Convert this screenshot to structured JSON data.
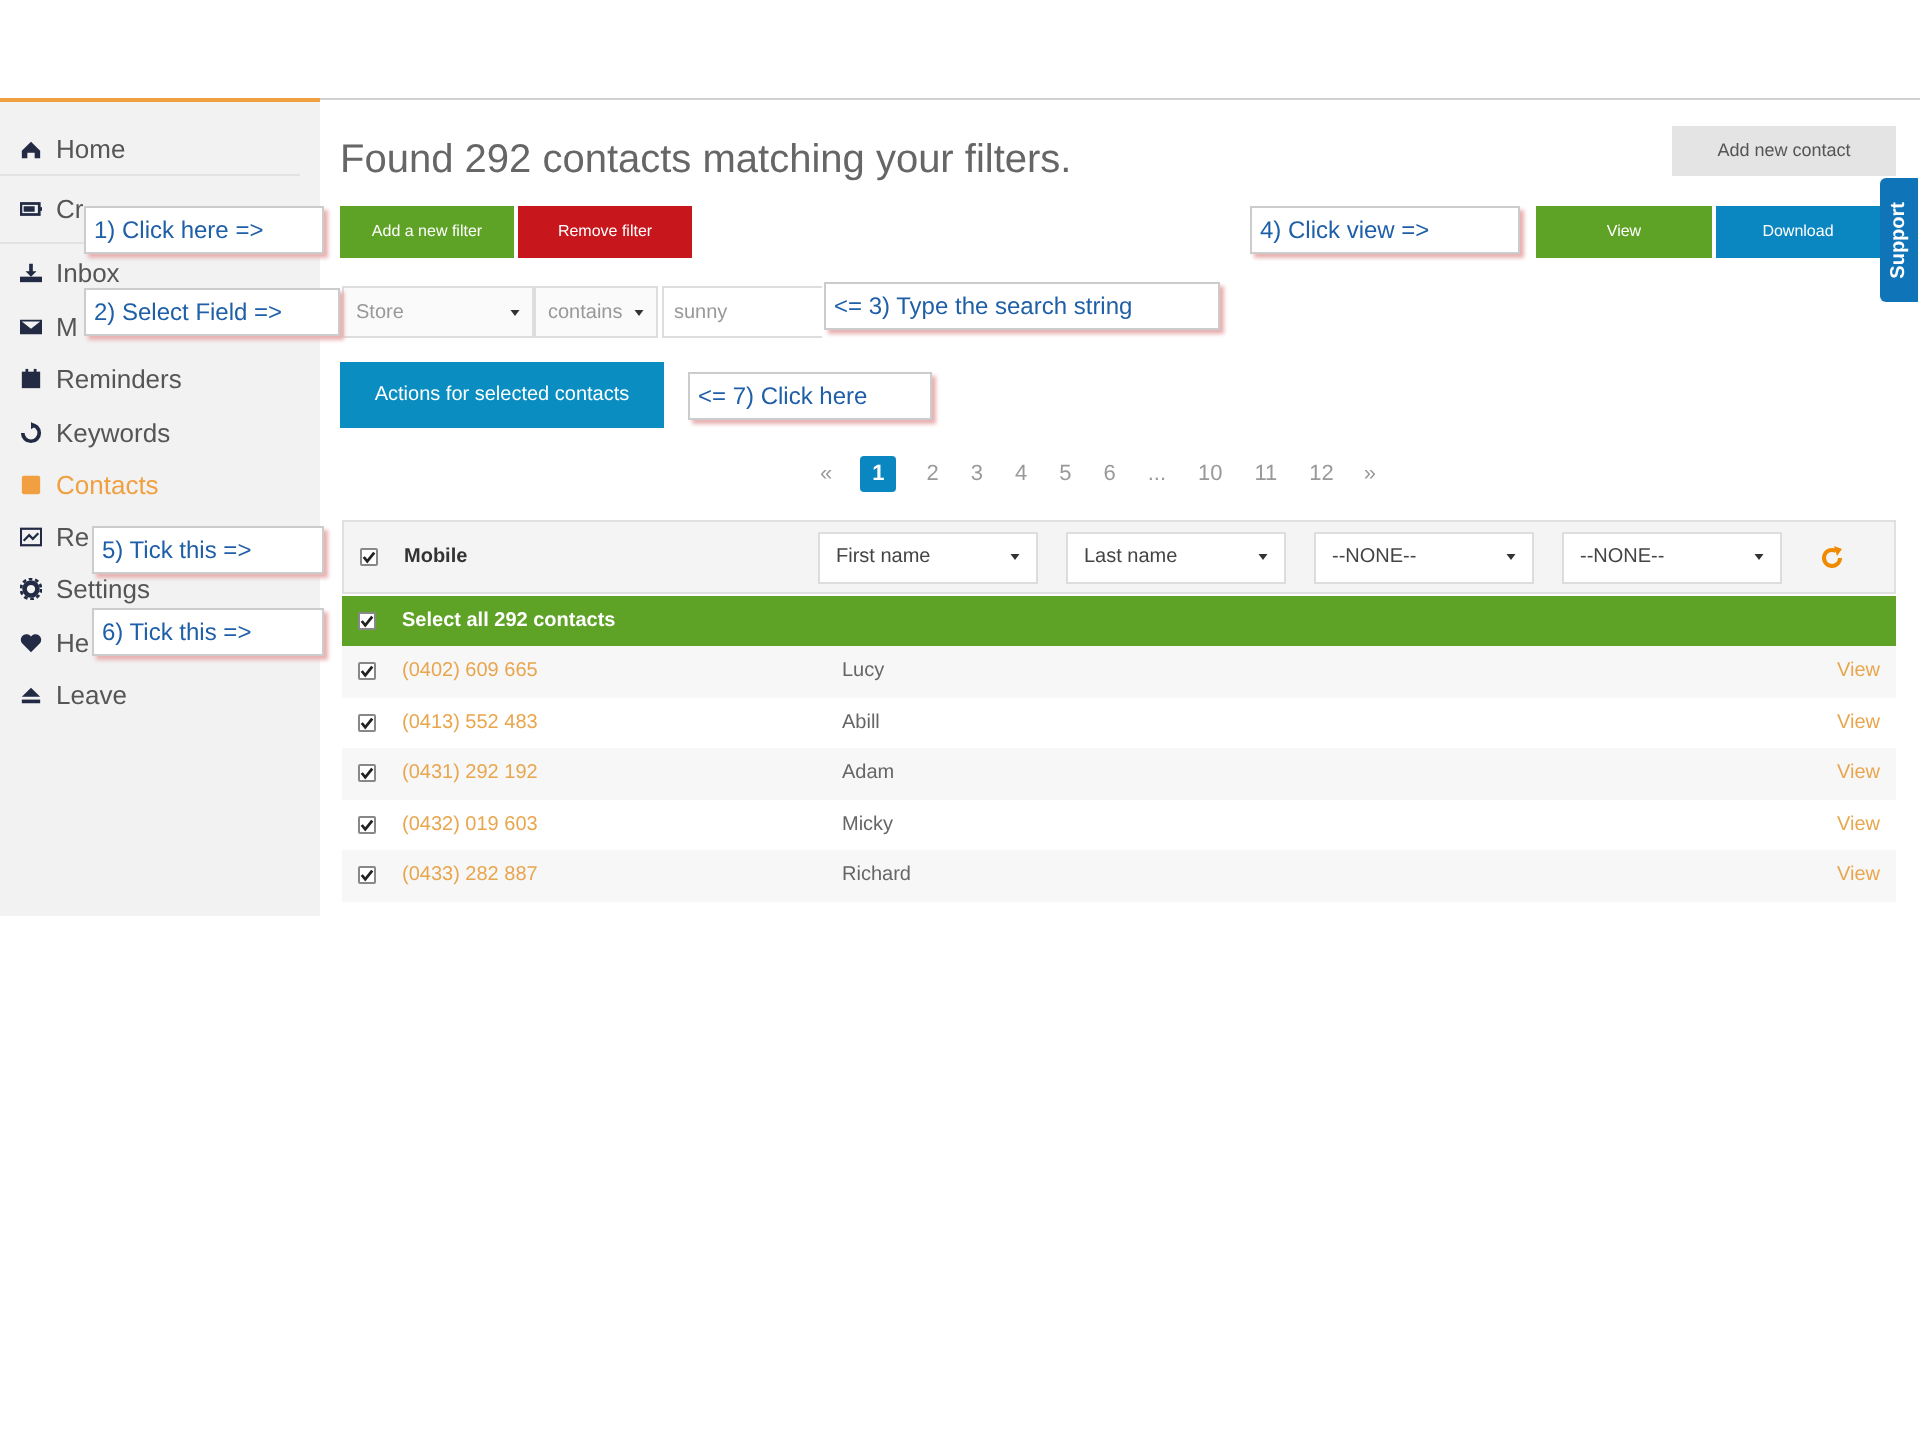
{
  "sidebar": {
    "items": [
      {
        "label": "Home",
        "selected": false
      },
      {
        "label": "Cr",
        "selected": false
      },
      {
        "label": "Inbox",
        "selected": false
      },
      {
        "label": "M",
        "selected": false
      },
      {
        "label": "Reminders",
        "selected": false
      },
      {
        "label": "Keywords",
        "selected": false
      },
      {
        "label": "Contacts",
        "selected": true
      },
      {
        "label": "Re",
        "selected": false
      },
      {
        "label": "Settings",
        "selected": false
      },
      {
        "label": "He",
        "selected": false
      },
      {
        "label": "Leave",
        "selected": false
      }
    ]
  },
  "heading": "Found 292 contacts matching your filters.",
  "add_contact_button": "Add new contact",
  "filter_buttons": [
    "Add a new filter",
    "Remove filter"
  ],
  "result_buttons": [
    "View",
    "Download"
  ],
  "support_tab": "Support",
  "filter": {
    "field": "Store",
    "operator": "contains",
    "value": "sunny"
  },
  "actions_button": "Actions for selected contacts",
  "pagination": {
    "prev": "«",
    "next": "»",
    "pages": [
      {
        "label": "1",
        "selected": true
      },
      {
        "label": "2",
        "selected": false
      },
      {
        "label": "3",
        "selected": false
      },
      {
        "label": "4",
        "selected": false
      },
      {
        "label": "5",
        "selected": false
      },
      {
        "label": "6",
        "selected": false
      },
      {
        "label": "...",
        "selected": false
      },
      {
        "label": "10",
        "selected": false
      },
      {
        "label": "11",
        "selected": false
      },
      {
        "label": "12",
        "selected": false
      }
    ]
  },
  "table": {
    "header": {
      "checked": true,
      "label": "Mobile",
      "column_selects": [
        "First name",
        "Last name",
        "--NONE--",
        "--NONE--"
      ]
    },
    "select_all": {
      "label": "Select all 292 contacts",
      "checked": true
    },
    "rows": [
      {
        "mobile": "(0402) 609 665",
        "first_name": "Lucy",
        "action": "View",
        "checked": true
      },
      {
        "mobile": "(0413) 552 483",
        "first_name": "Abill",
        "action": "View",
        "checked": true
      },
      {
        "mobile": "(0431) 292 192",
        "first_name": "Adam",
        "action": "View",
        "checked": true
      },
      {
        "mobile": "(0432) 019 603",
        "first_name": "Micky",
        "action": "View",
        "checked": true
      },
      {
        "mobile": "(0433) 282 887",
        "first_name": "Richard",
        "action": "View",
        "checked": true
      }
    ]
  },
  "annotations": [
    {
      "text": "1)  Click here =>"
    },
    {
      "text": "2) Select Field =>"
    },
    {
      "text": "<= 3) Type the search string"
    },
    {
      "text": "4) Click view =>"
    },
    {
      "text": "5) Tick this =>"
    },
    {
      "text": "6) Tick this =>"
    },
    {
      "text": "<= 7) Click here"
    }
  ]
}
